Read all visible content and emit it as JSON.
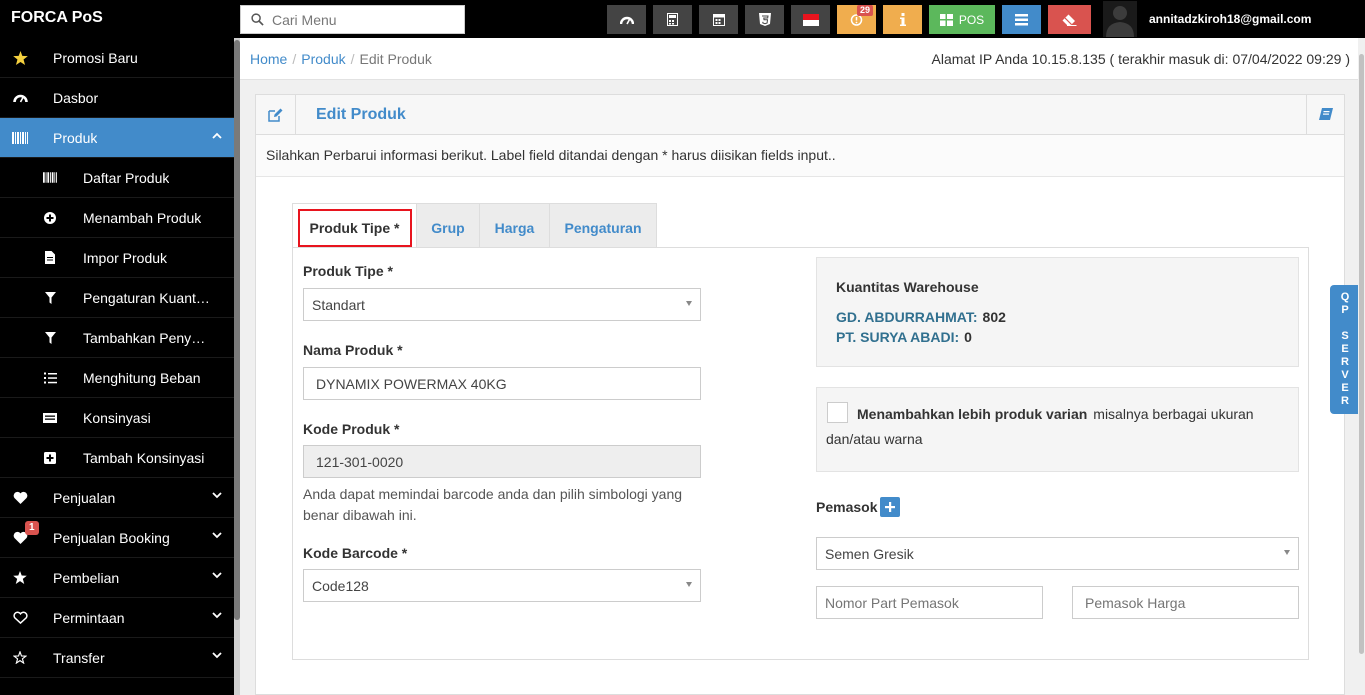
{
  "app": {
    "brand": "FORCA PoS"
  },
  "search": {
    "placeholder": "Cari Menu"
  },
  "toolbar": {
    "buttons": [
      {
        "icon": "dashboard-icon",
        "color": "#444444"
      },
      {
        "icon": "calculator-icon",
        "color": "#444444"
      },
      {
        "icon": "calendar-icon",
        "color": "#444444"
      },
      {
        "icon": "html5-icon",
        "color": "#444444"
      },
      {
        "icon": "indonesia-flag-icon",
        "color": "#444444"
      },
      {
        "icon": "alert-icon",
        "color": "#f0ad4e",
        "badge": "29"
      },
      {
        "icon": "info-icon",
        "color": "#f0ad4e"
      },
      {
        "icon": "pos-grid-icon",
        "color": "#5cb85c",
        "label": "POS"
      },
      {
        "icon": "list-icon",
        "color": "#428bca"
      },
      {
        "icon": "eraser-icon",
        "color": "#d9534f"
      }
    ],
    "user_email": "annitadzkiroh18@gmail.com"
  },
  "sidebar": {
    "items": [
      {
        "label": "Promosi Baru",
        "icon": "star-icon"
      },
      {
        "label": "Dasbor",
        "icon": "dashboard-icon"
      },
      {
        "label": "Produk",
        "icon": "barcode-icon",
        "active": true
      },
      {
        "label": "Daftar Produk",
        "icon": "barcode-icon",
        "sub": true
      },
      {
        "label": "Menambah Produk",
        "icon": "plus-circle-icon",
        "sub": true
      },
      {
        "label": "Impor Produk",
        "icon": "file-icon",
        "sub": true
      },
      {
        "label": "Pengaturan Kuantitas",
        "icon": "filter-icon",
        "sub": true
      },
      {
        "label": "Tambahkan Penyesuaian",
        "icon": "filter-icon",
        "sub": true
      },
      {
        "label": "Menghitung Beban",
        "icon": "list-ol-icon",
        "sub": true
      },
      {
        "label": "Konsinyasi",
        "icon": "card-icon",
        "sub": true
      },
      {
        "label": "Tambah Konsinyasi",
        "icon": "plus-square-icon",
        "sub": true
      },
      {
        "label": "Penjualan",
        "icon": "heart-icon"
      },
      {
        "label": "Penjualan Booking",
        "icon": "heart-icon",
        "badge": "1"
      },
      {
        "label": "Pembelian",
        "icon": "star-icon"
      },
      {
        "label": "Permintaan",
        "icon": "heart-outline-icon"
      },
      {
        "label": "Transfer",
        "icon": "star-outline-icon"
      }
    ]
  },
  "breadcrumb": {
    "home": "Home",
    "produk": "Produk",
    "current": "Edit Produk"
  },
  "ip_info": "Alamat IP Anda 10.15.8.135 ( terakhir masuk di: 07/04/2022 09:29 )",
  "panel": {
    "title": "Edit Produk",
    "intro": "Silahkan Perbarui informasi berikut. Label field ditandai dengan * harus diisikan fields input..",
    "tabs": [
      "Produk Tipe *",
      "Grup",
      "Harga",
      "Pengaturan"
    ]
  },
  "form": {
    "produk_tipe_label": "Produk Tipe *",
    "produk_tipe_value": "Standart",
    "nama_produk_label": "Nama Produk *",
    "nama_produk_value": "DYNAMIX POWERMAX 40KG",
    "kode_produk_label": "Kode Produk *",
    "kode_produk_value": "121-301-0020",
    "kode_produk_help": "Anda dapat memindai barcode anda dan pilih simbologi yang benar dibawah ini.",
    "kode_barcode_label": "Kode Barcode *",
    "kode_barcode_value": "Code128"
  },
  "warehouse": {
    "title": "Kuantitas Warehouse",
    "rows": [
      {
        "name": "GD. ABDURRAHMAT:",
        "qty": "802"
      },
      {
        "name": "PT. SURYA ABADI:",
        "qty": "0"
      }
    ]
  },
  "variant": {
    "bold": "Menambahkan lebih produk varian",
    "rest": "misalnya berbagai ukuran dan/atau warna"
  },
  "supplier": {
    "label": "Pemasok",
    "value": "Semen Gresik",
    "part_placeholder": "Nomor Part Pemasok",
    "price_placeholder": "Pemasok Harga"
  },
  "side_tab": "QP SERVER"
}
